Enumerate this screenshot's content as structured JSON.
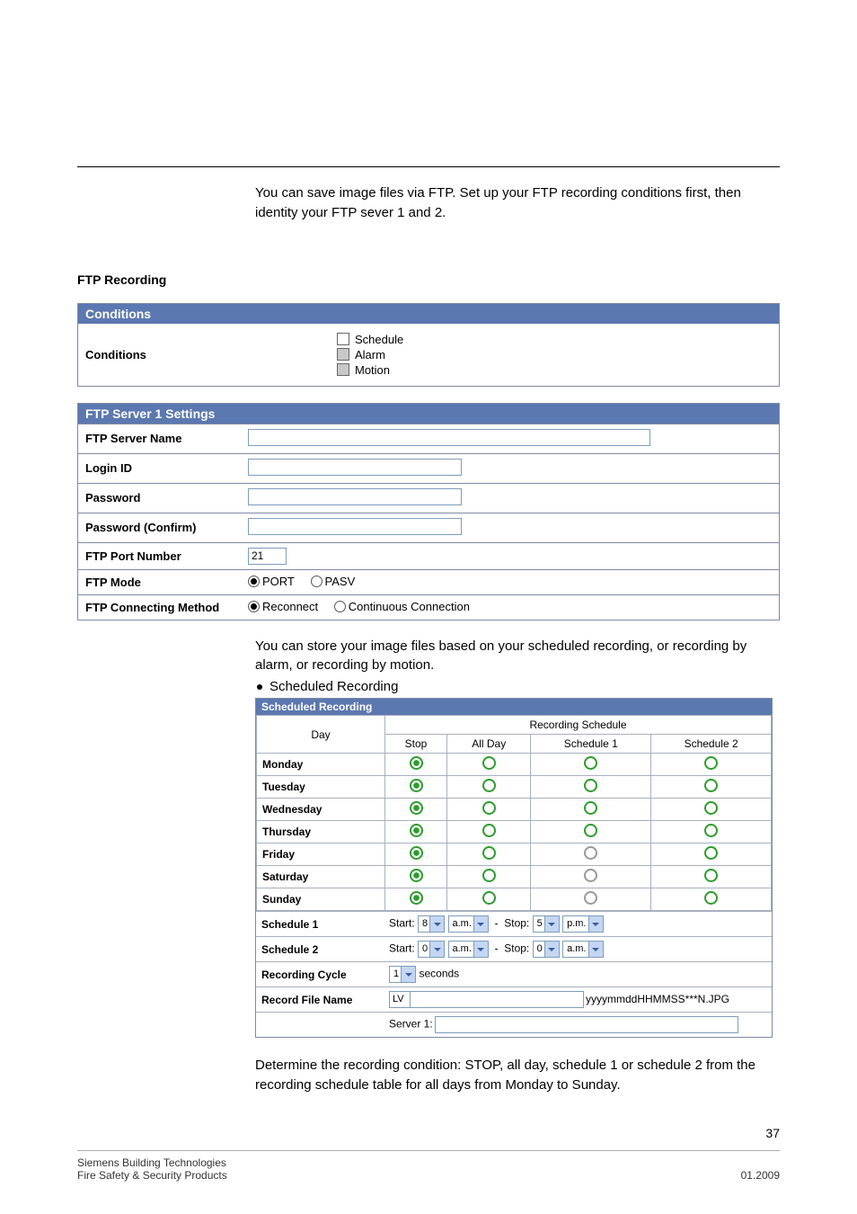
{
  "intro": "You can save image files via FTP. Set up your FTP recording conditions first, then identity your FTP sever 1 and 2.",
  "heading": "FTP Recording",
  "conditions": {
    "header": "Conditions",
    "label": "Conditions",
    "c1": "Schedule",
    "c2": "Alarm",
    "c3": "Motion"
  },
  "ftp": {
    "header": "FTP Server 1 Settings",
    "rows": {
      "serverName": "FTP Server Name",
      "loginId": "Login ID",
      "password": "Password",
      "passwordConfirm": "Password (Confirm)",
      "portNumber": "FTP Port Number",
      "portValue": "21",
      "mode": "FTP Mode",
      "mode1": "PORT",
      "mode2": "PASV",
      "connMethod": "FTP Connecting Method",
      "conn1": "Reconnect",
      "conn2": "Continuous Connection"
    }
  },
  "para2": "You can store your image files based on your scheduled recording, or recording by alarm, or recording by motion.",
  "bullet": "Scheduled Recording",
  "sched": {
    "header": "Scheduled Recording",
    "dayH": "Day",
    "recH": "Recording Schedule",
    "cols": {
      "stop": "Stop",
      "allday": "All Day",
      "s1": "Schedule 1",
      "s2": "Schedule 2"
    },
    "days": [
      "Monday",
      "Tuesday",
      "Wednesday",
      "Thursday",
      "Friday",
      "Saturday",
      "Sunday"
    ],
    "conf": {
      "s1label": "Schedule 1",
      "s2label": "Schedule 2",
      "start": "Start:",
      "stop": "Stop:",
      "s1startH": "8",
      "s1startM": "a.m.",
      "s1stopH": "5",
      "s1stopM": "p.m.",
      "s2startH": "0",
      "s2startM": "a.m.",
      "s2stopH": "0",
      "s2stopM": "a.m.",
      "recCycle": "Recording Cycle",
      "recCycleVal": "1",
      "recCycleUnit": "seconds",
      "fileName": "Record File Name",
      "fnPrefix": "LV",
      "fnSuffix": "yyyymmddHHMMSS***N.JPG",
      "server": "Server 1:"
    }
  },
  "para3": "Determine the recording condition: STOP, all day, schedule 1 or schedule 2 from the recording schedule table for all days from Monday to Sunday.",
  "pageNum": "37",
  "footer": {
    "l1": "Siemens Building Technologies",
    "l2": "Fire Safety & Security Products",
    "r": "01.2009"
  }
}
